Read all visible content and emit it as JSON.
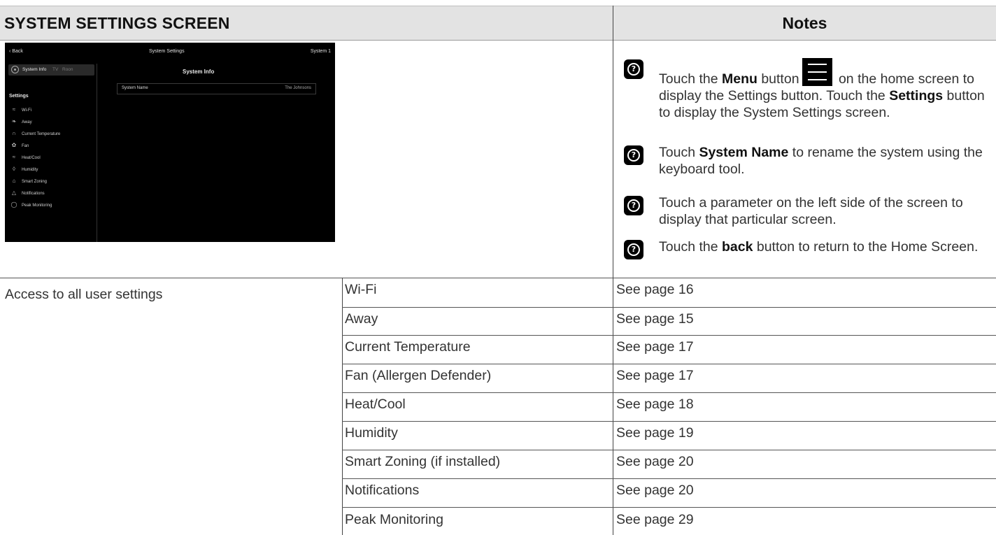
{
  "header": {
    "title": "SYSTEM SETTINGS SCREEN",
    "notes_title": "Notes"
  },
  "device": {
    "back_label": "Back",
    "screen_title": "System Settings",
    "system_label": "System 1",
    "tabs": {
      "system_info": "System Info",
      "tv": "TV",
      "room": "Roon"
    },
    "settings_heading": "Settings",
    "menu_items": [
      {
        "label": "Wi-Fi",
        "icon": "wifi-icon"
      },
      {
        "label": "Away",
        "icon": "leaf-icon"
      },
      {
        "label": "Current Temperature",
        "icon": "thermometer-icon"
      },
      {
        "label": "Fan",
        "icon": "fan-icon"
      },
      {
        "label": "Heat/Cool",
        "icon": "heat-cool-icon"
      },
      {
        "label": "Humidity",
        "icon": "droplet-icon"
      },
      {
        "label": "Smart Zoning",
        "icon": "zoning-icon"
      },
      {
        "label": "Notifications",
        "icon": "bell-icon"
      },
      {
        "label": "Peak Monitoring",
        "icon": "peak-icon"
      }
    ],
    "panel_title": "System Info",
    "system_name_label": "System Name",
    "system_name_value": "The Johnsons"
  },
  "notes": [
    {
      "pre": "Touch the ",
      "bold1": "Menu",
      "mid": " button",
      "post": " on the home screen to display the Settings button. Touch the ",
      "bold2": "Settings",
      "end": " button to display the System Settings screen."
    },
    {
      "pre": "Touch ",
      "bold1": "System Name",
      "post": " to rename the system using the keyboard tool."
    },
    {
      "text": "Touch a parameter on the left side of the screen to display that particular screen."
    },
    {
      "pre": "Touch the ",
      "bold1": "back",
      "post": " button to return to the Home Screen."
    }
  ],
  "table": {
    "access_label": "Access to all user settings",
    "rows": [
      {
        "name": "Wi-Fi",
        "page": "See page 16"
      },
      {
        "name": "Away",
        "page": "See page 15"
      },
      {
        "name": "Current Temperature",
        "page": "See page 17"
      },
      {
        "name": "Fan (Allergen Defender)",
        "page": "See page 17"
      },
      {
        "name": "Heat/Cool",
        "page": "See page 18"
      },
      {
        "name": "Humidity",
        "page": "See page 19"
      },
      {
        "name": "Smart Zoning (if installed)",
        "page": "See page 20"
      },
      {
        "name": "Notifications",
        "page": "See page 20"
      },
      {
        "name": "Peak Monitoring",
        "page": "See page 29"
      }
    ]
  }
}
